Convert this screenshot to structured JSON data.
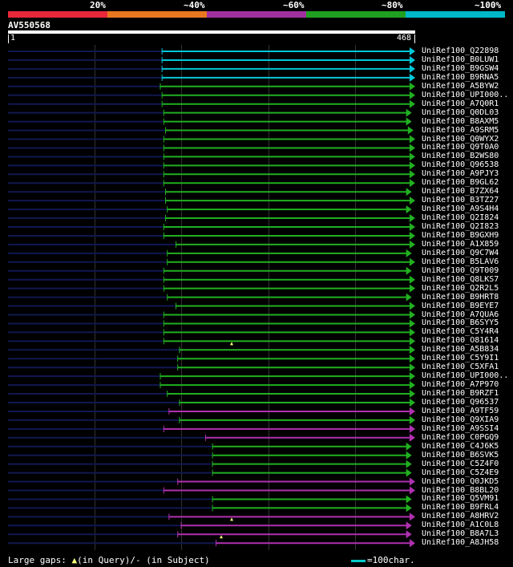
{
  "legend": {
    "labels": [
      "20%",
      "~40%",
      "~60%",
      "~80%",
      "~100%"
    ],
    "colors": [
      "#e8283a",
      "#e87820",
      "#a030a0",
      "#20a020",
      "#00b8c8"
    ]
  },
  "query": {
    "id": "AV550568",
    "start": "1",
    "end": "468",
    "length": 468
  },
  "chart_data": {
    "type": "alignment",
    "x_range": [
      1,
      468
    ],
    "colors": {
      "cyan": "#00c8d8",
      "green": "#20b020",
      "purple": "#b030b0",
      "navy": "#101850",
      "gap": "#204020"
    },
    "hits": [
      {
        "id": "UniRef100_Q22898",
        "start": 178,
        "end": 468,
        "color": "cyan"
      },
      {
        "id": "UniRef100_B0LUW1",
        "start": 178,
        "end": 468,
        "color": "cyan"
      },
      {
        "id": "UniRef100_B9GSW4",
        "start": 178,
        "end": 468,
        "color": "cyan"
      },
      {
        "id": "UniRef100_B9RNA5",
        "start": 178,
        "end": 468,
        "color": "cyan"
      },
      {
        "id": "UniRef100_A5BYW2",
        "start": 176,
        "end": 468,
        "color": "green"
      },
      {
        "id": "UniRef100_UPI000..",
        "start": 178,
        "end": 468,
        "color": "green"
      },
      {
        "id": "UniRef100_A7Q0R1",
        "start": 178,
        "end": 468,
        "color": "green"
      },
      {
        "id": "UniRef100_Q0DL03",
        "start": 180,
        "end": 464,
        "color": "green"
      },
      {
        "id": "UniRef100_B8AXM5",
        "start": 180,
        "end": 464,
        "color": "green"
      },
      {
        "id": "UniRef100_A9SRM5",
        "start": 182,
        "end": 466,
        "color": "green"
      },
      {
        "id": "UniRef100_Q0WYX2",
        "start": 180,
        "end": 468,
        "color": "green"
      },
      {
        "id": "UniRef100_Q9T0A0",
        "start": 180,
        "end": 468,
        "color": "green"
      },
      {
        "id": "UniRef100_B2WS80",
        "start": 180,
        "end": 468,
        "color": "green"
      },
      {
        "id": "UniRef100_Q96538",
        "start": 180,
        "end": 468,
        "color": "green"
      },
      {
        "id": "UniRef100_A9PJY3",
        "start": 180,
        "end": 468,
        "color": "green"
      },
      {
        "id": "UniRef100_B9GL62",
        "start": 180,
        "end": 468,
        "color": "green"
      },
      {
        "id": "UniRef100_B7ZX64",
        "start": 182,
        "end": 464,
        "color": "green"
      },
      {
        "id": "UniRef100_B3TZ27",
        "start": 182,
        "end": 468,
        "color": "green"
      },
      {
        "id": "UniRef100_A9S4H4",
        "start": 184,
        "end": 464,
        "color": "green"
      },
      {
        "id": "UniRef100_Q2I824",
        "start": 182,
        "end": 468,
        "color": "green"
      },
      {
        "id": "UniRef100_Q2I823",
        "start": 180,
        "end": 468,
        "color": "green"
      },
      {
        "id": "UniRef100_B9GXH9",
        "start": 180,
        "end": 468,
        "color": "green"
      },
      {
        "id": "UniRef100_A1X859",
        "start": 194,
        "end": 468,
        "color": "green"
      },
      {
        "id": "UniRef100_Q9C7W4",
        "start": 184,
        "end": 464,
        "color": "green"
      },
      {
        "id": "UniRef100_B5LAV6",
        "start": 184,
        "end": 468,
        "color": "green"
      },
      {
        "id": "UniRef100_Q9T009",
        "start": 180,
        "end": 464,
        "color": "green"
      },
      {
        "id": "UniRef100_Q8LKS7",
        "start": 180,
        "end": 468,
        "color": "green"
      },
      {
        "id": "UniRef100_Q2R2L5",
        "start": 180,
        "end": 468,
        "color": "green"
      },
      {
        "id": "UniRef100_B9HRT8",
        "start": 184,
        "end": 464,
        "color": "green"
      },
      {
        "id": "UniRef100_B9EYE7",
        "start": 194,
        "end": 468,
        "color": "green"
      },
      {
        "id": "UniRef100_A7QUA6",
        "start": 180,
        "end": 468,
        "color": "green"
      },
      {
        "id": "UniRef100_B6SYY5",
        "start": 180,
        "end": 468,
        "color": "green"
      },
      {
        "id": "UniRef100_C5Y4R4",
        "start": 180,
        "end": 468,
        "color": "green"
      },
      {
        "id": "UniRef100_O81614",
        "start": 180,
        "end": 468,
        "color": "green",
        "marker": 258
      },
      {
        "id": "UniRef100_A5B834",
        "start": 198,
        "end": 468,
        "color": "green"
      },
      {
        "id": "UniRef100_C5Y9I1",
        "start": 196,
        "end": 468,
        "color": "green"
      },
      {
        "id": "UniRef100_C5XFA1",
        "start": 196,
        "end": 468,
        "color": "green"
      },
      {
        "id": "UniRef100_UPI000..",
        "start": 176,
        "end": 468,
        "color": "green"
      },
      {
        "id": "UniRef100_A7P970",
        "start": 176,
        "end": 468,
        "color": "green"
      },
      {
        "id": "UniRef100_B9RZF1",
        "start": 184,
        "end": 468,
        "color": "green"
      },
      {
        "id": "UniRef100_Q96537",
        "start": 198,
        "end": 468,
        "color": "green"
      },
      {
        "id": "UniRef100_A9TF59",
        "start": 186,
        "end": 468,
        "color": "purple"
      },
      {
        "id": "UniRef100_Q9XIA9",
        "start": 198,
        "end": 468,
        "color": "green"
      },
      {
        "id": "UniRef100_A9SSI4",
        "start": 180,
        "end": 468,
        "color": "purple"
      },
      {
        "id": "UniRef100_C0PGQ9",
        "start": 228,
        "end": 468,
        "color": "purple"
      },
      {
        "id": "UniRef100_C4J6K5",
        "start": 236,
        "end": 464,
        "color": "green"
      },
      {
        "id": "UniRef100_B6SVK5",
        "start": 236,
        "end": 464,
        "color": "green"
      },
      {
        "id": "UniRef100_C5Z4F0",
        "start": 236,
        "end": 464,
        "color": "green"
      },
      {
        "id": "UniRef100_C5Z4E9",
        "start": 236,
        "end": 464,
        "color": "green"
      },
      {
        "id": "UniRef100_Q0JKD5",
        "start": 196,
        "end": 468,
        "color": "purple"
      },
      {
        "id": "UniRef100_B8BL20",
        "start": 180,
        "end": 468,
        "color": "purple"
      },
      {
        "id": "UniRef100_Q5VM91",
        "start": 236,
        "end": 464,
        "color": "green"
      },
      {
        "id": "UniRef100_B9FRL4",
        "start": 236,
        "end": 464,
        "color": "green"
      },
      {
        "id": "UniRef100_A8HRV2",
        "start": 186,
        "end": 468,
        "color": "purple",
        "marker": 258
      },
      {
        "id": "UniRef100_A1C0L8",
        "start": 200,
        "end": 464,
        "color": "purple"
      },
      {
        "id": "UniRef100_B8A7L3",
        "start": 196,
        "end": 464,
        "color": "purple",
        "marker": 246
      },
      {
        "id": "UniRef100_A8JH58",
        "start": 240,
        "end": 468,
        "color": "purple"
      }
    ]
  },
  "footer": {
    "large_gaps": "Large gaps: ",
    "in_query": "(in Query)/",
    "in_subject": "- (in Subject)",
    "scale": "=100char."
  }
}
